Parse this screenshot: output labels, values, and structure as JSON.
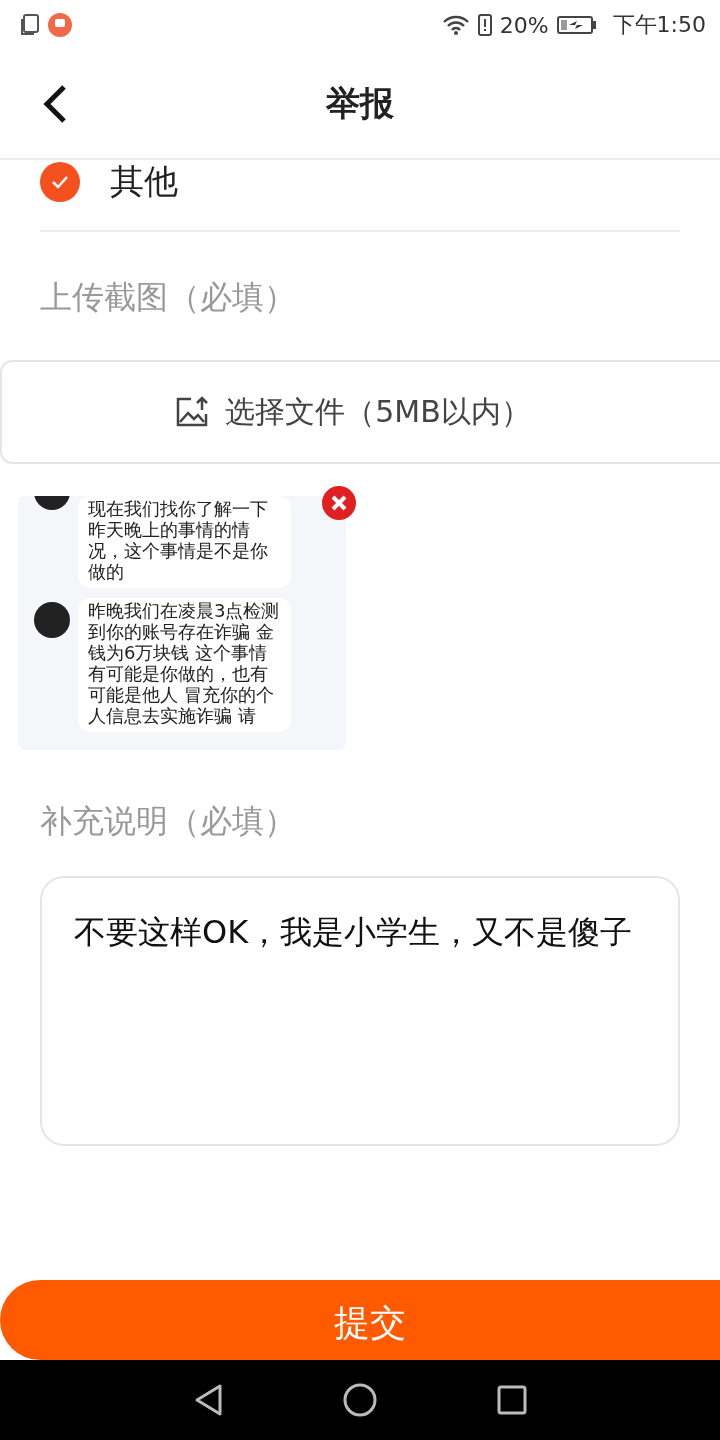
{
  "status_bar": {
    "battery": "20%",
    "time": "下午1:50"
  },
  "header": {
    "title": "举报"
  },
  "options": [
    {
      "label": "其他",
      "checked": true
    }
  ],
  "upload": {
    "label": "上传截图（必填）",
    "button": "选择文件（5MB以内）"
  },
  "screenshot": {
    "messages": [
      "现在我们找你了解一下昨天晚上的事情的情况，这个事情是不是你做的",
      "昨晚我们在凌晨3点检测到你的账号存在诈骗 金钱为6万块钱 这个事情有可能是你做的，也有可能是他人 冒充你的个人信息去实施诈骗  请"
    ]
  },
  "note": {
    "label": "补充说明（必填）",
    "value": "不要这样OK，我是小学生，又不是傻子"
  },
  "submit": "提交"
}
